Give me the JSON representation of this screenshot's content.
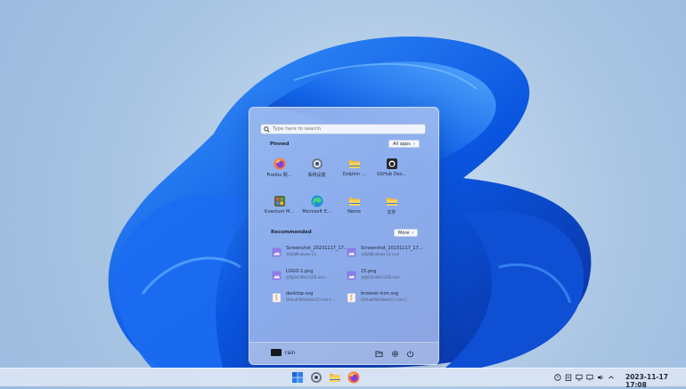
{
  "start_menu": {
    "search_placeholder": "Type here to search",
    "pinned_title": "Pinned",
    "all_apps_label": "All apps",
    "recommended_title": "Recommended",
    "more_label": "More",
    "pinned": [
      {
        "label": "Firefox 网...",
        "icon": "firefox-icon"
      },
      {
        "label": "系统设置",
        "icon": "settings-icon"
      },
      {
        "label": "Dolphin ...",
        "icon": "folder-icon"
      },
      {
        "label": "GitHub Des...",
        "icon": "github-icon"
      },
      {
        "label": "Kvantum M...",
        "icon": "kvantum-icon"
      },
      {
        "label": "Microsoft E...",
        "icon": "edge-icon"
      },
      {
        "label": "Nemo",
        "icon": "folder-icon"
      },
      {
        "label": "文件",
        "icon": "folder-icon"
      }
    ],
    "recommended": [
      {
        "name": "Screenshot_20231117_17...",
        "path": "文档/Windows-11",
        "icon": "image-file-icon"
      },
      {
        "name": "Screenshot_20231117_17...",
        "path": "文档/Windows-11-icon",
        "icon": "image-file-icon"
      },
      {
        "name": "LOGO-1.png",
        "path": "文档/24-Win11OS-icon",
        "icon": "image-file-icon"
      },
      {
        "name": "15.png",
        "path": "文档/24-Win11OS-icon",
        "icon": "image-file-icon"
      },
      {
        "name": "desktop.svg",
        "path": "Github/Windows11-icon-t...",
        "icon": "svg-file-icon"
      },
      {
        "name": "browser-icon.svg",
        "path": "Github/Windows11-icon-t...",
        "icon": "svg-file-icon"
      }
    ],
    "user_name": "rain"
  },
  "taskbar": {
    "clock": "2023-11-17 17:08"
  },
  "colors": {
    "accent": "#1e63d6",
    "folder": "#f2b73a"
  }
}
